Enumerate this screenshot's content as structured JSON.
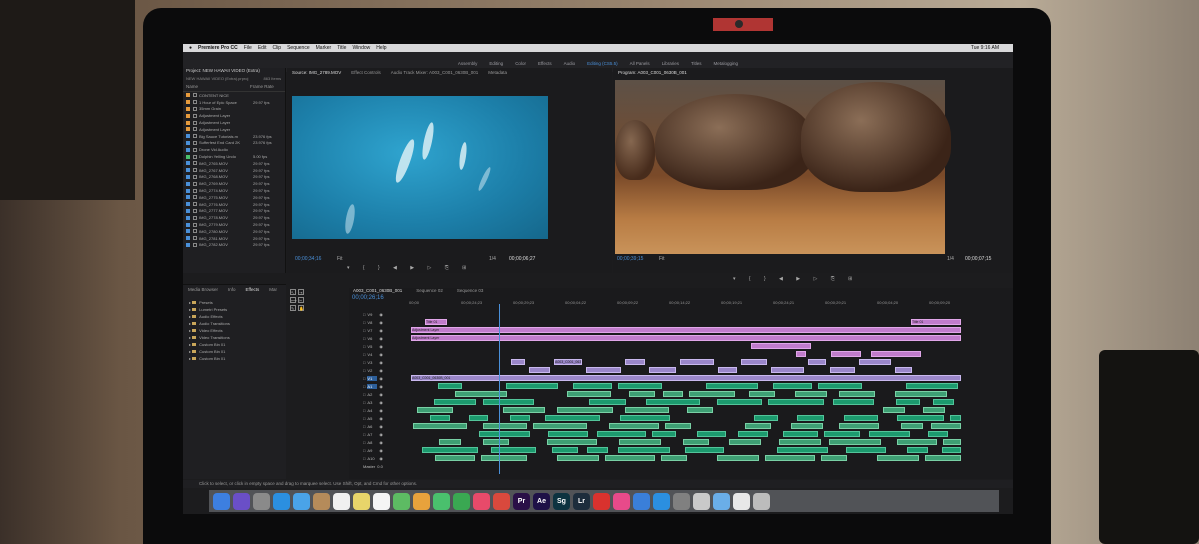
{
  "menubar": {
    "app_name": "Premiere Pro CC",
    "items": [
      "File",
      "Edit",
      "Clip",
      "Sequence",
      "Marker",
      "Title",
      "Window",
      "Help"
    ],
    "clock": "Tue 9:16 AM"
  },
  "workspaces": {
    "items": [
      "Assembly",
      "Editing",
      "Color",
      "Effects",
      "Audio",
      "Editing (CS5.5)",
      "All Panels",
      "Libraries",
      "Titles",
      "Metalogging"
    ],
    "active": "Editing (CS5.5)"
  },
  "project_panel": {
    "title": "Project: NEW HAWAII VIDEO (Extra)",
    "file": "NEW HAWAII VIDEO (Extra).prproj",
    "count": "863 Items",
    "col_name": "Name",
    "col_rate": "Frame Rate",
    "items": [
      {
        "name": "CONTENT NICE",
        "rate": "",
        "color": "#e59a3c"
      },
      {
        "name": "1 Hour of Epic Space",
        "rate": "29.97 fps",
        "color": "#e59a3c"
      },
      {
        "name": "35mm Grain",
        "rate": "",
        "color": "#e59a3c"
      },
      {
        "name": "Adjustment Layer",
        "rate": "",
        "color": "#e59a3c"
      },
      {
        "name": "Adjustment Layer",
        "rate": "",
        "color": "#e59a3c"
      },
      {
        "name": "Adjustment Layer",
        "rate": "",
        "color": "#e59a3c"
      },
      {
        "name": "Big Sauce Tutorials.m",
        "rate": "23.976 fps",
        "color": "#4a90d9"
      },
      {
        "name": "Sufferfest End Card 2K",
        "rate": "23.976 fps",
        "color": "#4a90d9"
      },
      {
        "name": "Drone Vid Audio",
        "rate": "",
        "color": "#4a90d9"
      },
      {
        "name": "Dolphin Yelling Undo",
        "rate": "5.00 fps",
        "color": "#4ac06d"
      },
      {
        "name": "IMG_2765.MOV",
        "rate": "29.97 fps",
        "color": "#4a90d9"
      },
      {
        "name": "IMG_2767.MOV",
        "rate": "29.97 fps",
        "color": "#4a90d9"
      },
      {
        "name": "IMG_2768.MOV",
        "rate": "29.97 fps",
        "color": "#4a90d9"
      },
      {
        "name": "IMG_2769.MOV",
        "rate": "29.97 fps",
        "color": "#4a90d9"
      },
      {
        "name": "IMG_2774.MOV",
        "rate": "29.97 fps",
        "color": "#4a90d9"
      },
      {
        "name": "IMG_2775.MOV",
        "rate": "29.97 fps",
        "color": "#4a90d9"
      },
      {
        "name": "IMG_2776.MOV",
        "rate": "29.97 fps",
        "color": "#4a90d9"
      },
      {
        "name": "IMG_2777.MOV",
        "rate": "29.97 fps",
        "color": "#4a90d9"
      },
      {
        "name": "IMG_2778.MOV",
        "rate": "29.97 fps",
        "color": "#4a90d9"
      },
      {
        "name": "IMG_2779.MOV",
        "rate": "29.97 fps",
        "color": "#4a90d9"
      },
      {
        "name": "IMG_2780.MOV",
        "rate": "29.97 fps",
        "color": "#4a90d9"
      },
      {
        "name": "IMG_2781.MOV",
        "rate": "29.97 fps",
        "color": "#4a90d9"
      },
      {
        "name": "IMG_2782.MOV",
        "rate": "29.97 fps",
        "color": "#4a90d9"
      }
    ]
  },
  "source_panel": {
    "tabs": [
      "Source: IMG_2789.MOV",
      "Effect Controls",
      "Audio Track Mixer: A003_C001_0630B_001",
      "Metadata"
    ],
    "timecode_in": "00;00;34;16",
    "fit": "Fit",
    "scale": "1/4",
    "timecode_out": "00;00;06;27"
  },
  "program_panel": {
    "title": "Program: A003_C001_0630B_001",
    "timecode_in": "00;00;39;15",
    "fit": "Fit",
    "scale": "1/4",
    "timecode_out": "00;00;07;15"
  },
  "effects_panel": {
    "tabs": [
      "Media Browser",
      "Info",
      "Effects",
      "Mar"
    ],
    "items": [
      "Presets",
      "Lumetri Presets",
      "Audio Effects",
      "Audio Transitions",
      "Video Effects",
      "Video Transitions",
      "Custom Bin 01",
      "Custom Bin 01",
      "Custom Bin 01"
    ]
  },
  "timeline": {
    "tabs": [
      "A003_C001_0630B_001",
      "Sequence 02",
      "Sequence 03"
    ],
    "timecode": "00;00;26;16",
    "ruler": [
      "00;00",
      "00;00;24;23",
      "00;00;29;23",
      "00;00;04;22",
      "00;00;09;22",
      "00;00;14;22",
      "00;00;19;21",
      "00;00;24;21",
      "00;00;29;21",
      "00;00;04;20",
      "00;00;09;20"
    ],
    "video_tracks": [
      "V9",
      "V8",
      "V7",
      "V6",
      "V5",
      "V4",
      "V3",
      "V2",
      "V1"
    ],
    "audio_tracks": [
      "A1",
      "A2",
      "A3",
      "A4",
      "A5",
      "A6",
      "A7",
      "A8",
      "A9",
      "A10"
    ],
    "master": "Master",
    "master_value": "0.0",
    "labels": {
      "adjust": "Adjustment Layer",
      "title": "Title 01",
      "clip": "A003_C001_0630B_001"
    }
  },
  "statusbar": {
    "text": "Click to select, or click in empty space and drag to marquee select. Use Shift, Opt, and Cmd for other options."
  },
  "dock": {
    "items": [
      {
        "label": "",
        "icon": "finder-icon",
        "color": "#3d7fe0"
      },
      {
        "label": "",
        "icon": "siri-icon",
        "color": "#6a4fc7"
      },
      {
        "label": "",
        "icon": "launchpad-icon",
        "color": "#8a8a8a"
      },
      {
        "label": "",
        "icon": "safari-icon",
        "color": "#2b8fe0"
      },
      {
        "label": "",
        "icon": "mail-icon",
        "color": "#4aa3e8"
      },
      {
        "label": "",
        "icon": "contacts-icon",
        "color": "#b58b5a"
      },
      {
        "label": "",
        "icon": "calendar-icon",
        "color": "#f0f0f0"
      },
      {
        "label": "",
        "icon": "notes-icon",
        "color": "#e8d56a"
      },
      {
        "label": "",
        "icon": "reminders-icon",
        "color": "#f5f5f5"
      },
      {
        "label": "",
        "icon": "maps-icon",
        "color": "#5dbb63"
      },
      {
        "label": "",
        "icon": "photos-icon",
        "color": "#e8a23c"
      },
      {
        "label": "",
        "icon": "messages-icon",
        "color": "#4ac06d"
      },
      {
        "label": "",
        "icon": "facetime-icon",
        "color": "#3aa852"
      },
      {
        "label": "",
        "icon": "music-icon",
        "color": "#e84a6a"
      },
      {
        "label": "",
        "icon": "chrome-icon",
        "color": "#d9493d"
      },
      {
        "label": "Pr",
        "icon": "premiere-icon",
        "color": "#2a0f47"
      },
      {
        "label": "Ae",
        "icon": "aftereffects-icon",
        "color": "#1e1147"
      },
      {
        "label": "Sg",
        "icon": "speedgrade-icon",
        "color": "#0d3340"
      },
      {
        "label": "Lr",
        "icon": "lightroom-icon",
        "color": "#1d2d3c"
      },
      {
        "label": "",
        "icon": "creative-cloud-icon",
        "color": "#d9322e"
      },
      {
        "label": "",
        "icon": "itunes-icon",
        "color": "#e84a8a"
      },
      {
        "label": "",
        "icon": "keynote-icon",
        "color": "#3a7fd9"
      },
      {
        "label": "",
        "icon": "appstore-icon",
        "color": "#2b8fe0"
      },
      {
        "label": "",
        "icon": "preferences-icon",
        "color": "#808080"
      },
      {
        "label": "",
        "icon": "preview-icon",
        "color": "#c9c9c9"
      },
      {
        "label": "",
        "icon": "folder-icon",
        "color": "#6aaee8"
      },
      {
        "label": "",
        "icon": "document-icon",
        "color": "#e8e8e8"
      },
      {
        "label": "",
        "icon": "trash-icon",
        "color": "#bcbcbc"
      }
    ]
  }
}
